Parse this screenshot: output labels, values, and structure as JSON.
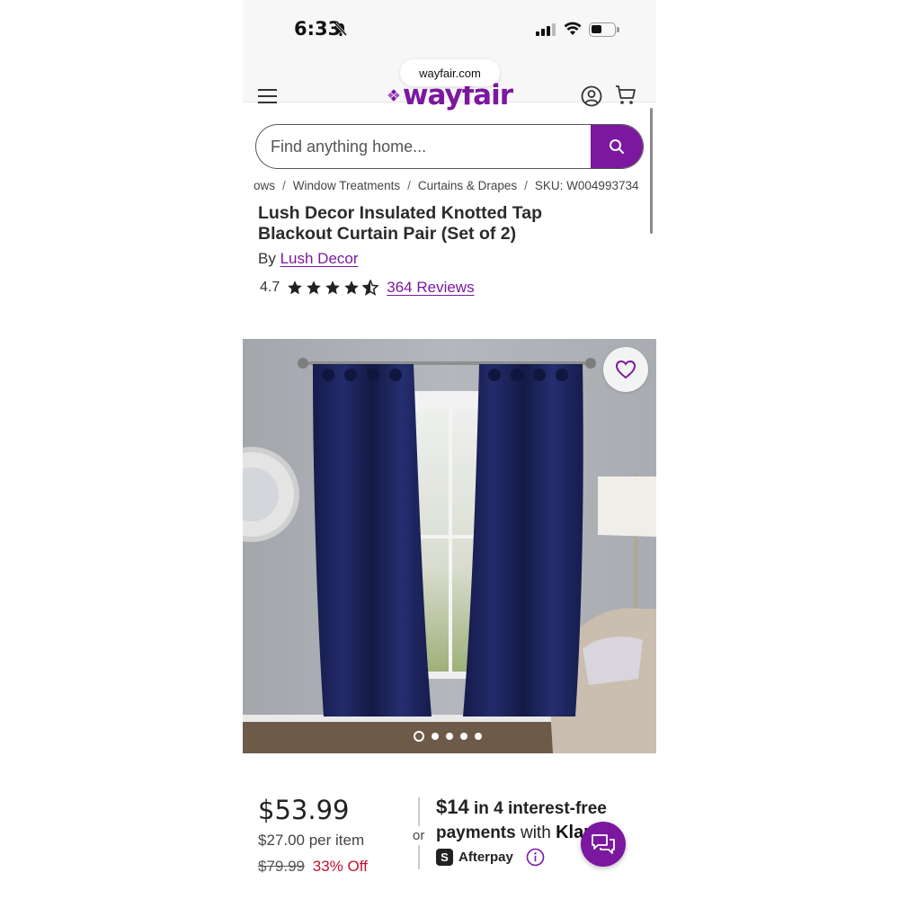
{
  "status_bar": {
    "time": "6:33"
  },
  "browser": {
    "url": "wayfair.com"
  },
  "header": {
    "logo_text": "wayfair",
    "brand_color": "#7b189f"
  },
  "search": {
    "placeholder": "Find anything home..."
  },
  "breadcrumb": {
    "items": [
      "ows",
      "Window Treatments",
      "Curtains & Drapes",
      "SKU: W004993734"
    ],
    "separator": "/"
  },
  "product": {
    "title": "Lush Decor Insulated Knotted Tap Blackout Curtain Pair (Set of 2)",
    "by_label": "By",
    "brand": "Lush Decor",
    "rating": "4.7",
    "rating_value": 4.7,
    "reviews_label": "364 Reviews",
    "image_count": 5,
    "active_image": 1
  },
  "pricing": {
    "price": "$53.99",
    "per_item": "$27.00 per item",
    "original_price": "$79.99",
    "discount": "33% Off",
    "or_label": "or",
    "installment_amount": "$14",
    "installment_text_1": "in 4 interest-free",
    "installment_text_2_bold": "payments",
    "installment_text_2": "with",
    "klarna_label": "Klarn",
    "afterpay_label": "Afterpay",
    "afterpay_badge": "S"
  },
  "icons": {
    "menu": "hamburger-icon",
    "account": "account-icon",
    "cart": "cart-icon",
    "search": "search-icon",
    "favorite": "heart-icon",
    "chat": "chat-icon",
    "info": "info-icon"
  }
}
